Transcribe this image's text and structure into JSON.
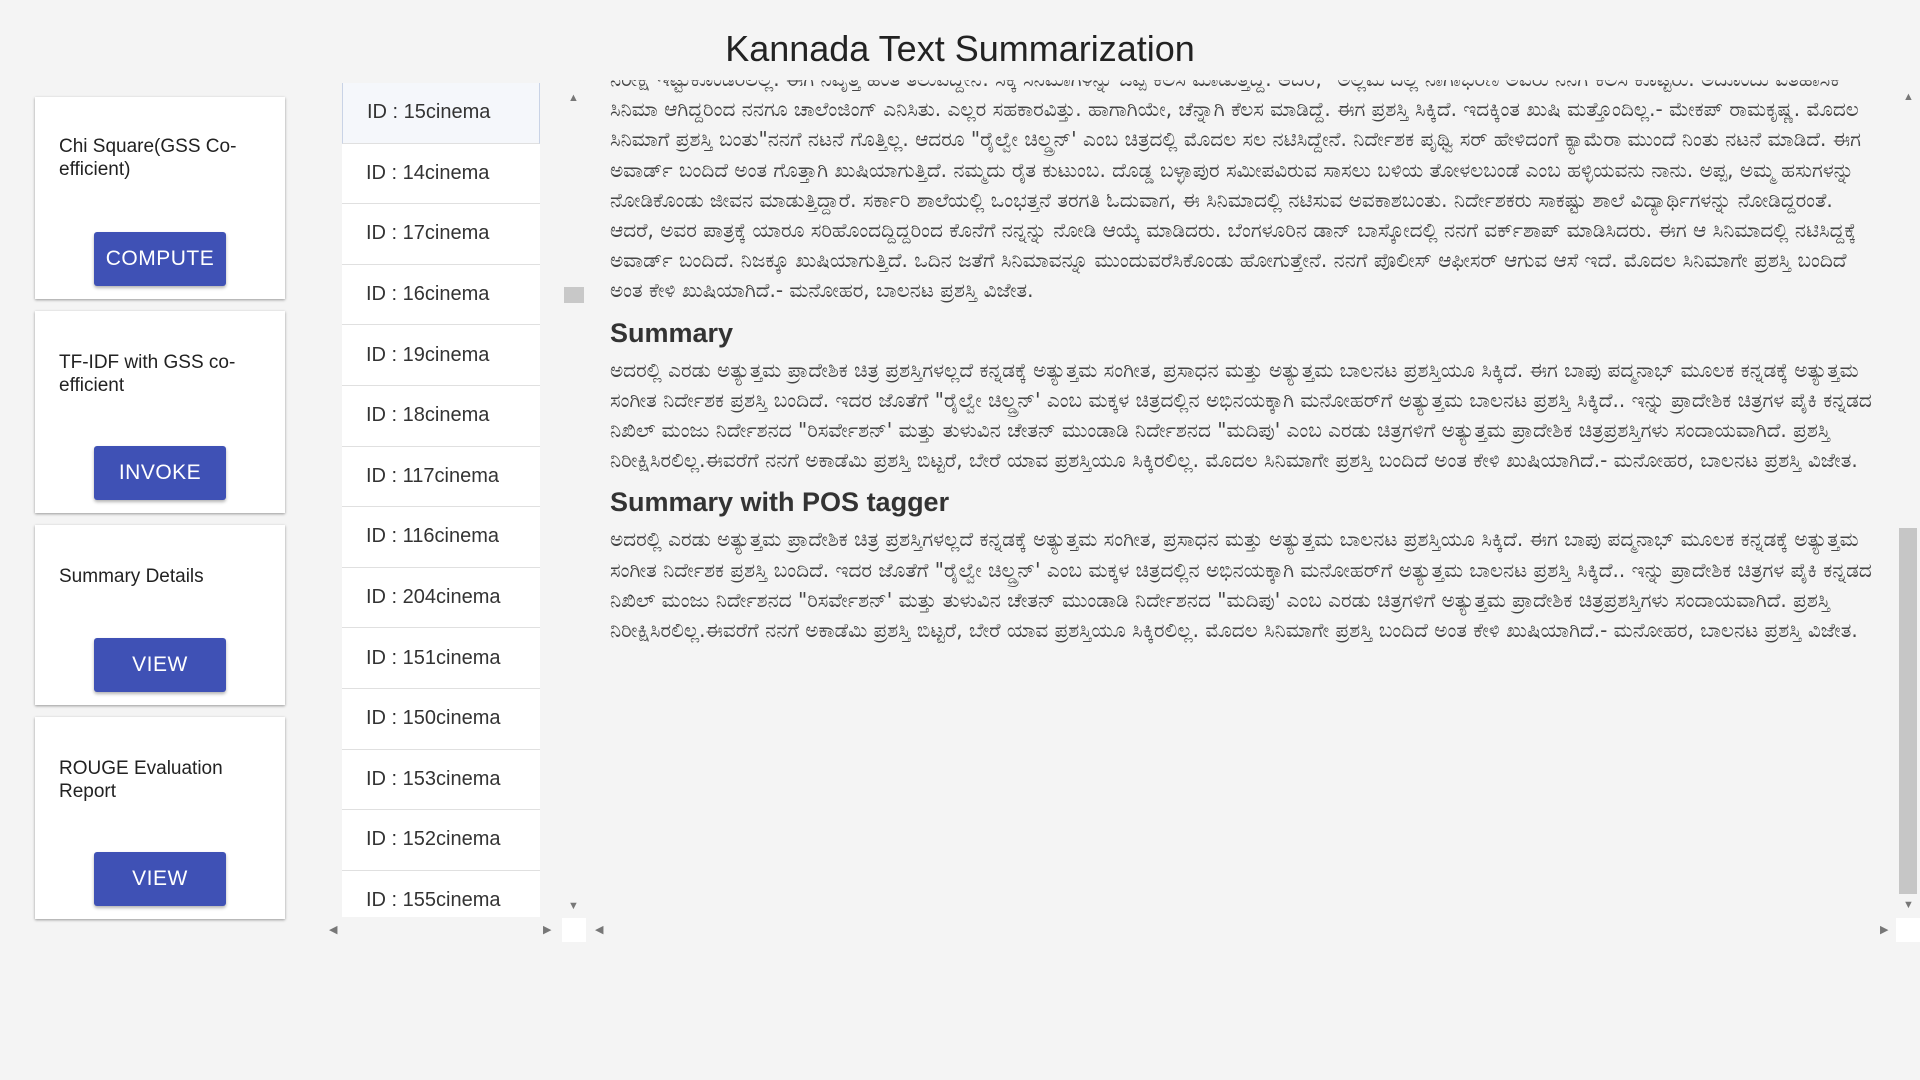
{
  "page": {
    "title": "Kannada Text Summarization"
  },
  "cards": [
    {
      "title": "Chi Square(GSS Co-efficient)",
      "button": "COMPUTE"
    },
    {
      "title": "TF-IDF with GSS co-efficient",
      "button": "INVOKE"
    },
    {
      "title": "Summary Details",
      "button": "VIEW"
    },
    {
      "title": "ROUGE Evaluation Report",
      "button": "VIEW"
    }
  ],
  "ids": [
    "ID : 15cinema",
    "ID : 14cinema",
    "ID : 17cinema",
    "ID : 16cinema",
    "ID : 19cinema",
    "ID : 18cinema",
    "ID : 117cinema",
    "ID : 116cinema",
    "ID : 204cinema",
    "ID : 151cinema",
    "ID : 150cinema",
    "ID : 153cinema",
    "ID : 152cinema",
    "ID : 155cinema"
  ],
  "content": {
    "original_text": "ನಿರೀಕ್ಷೆ ಇಟ್ಟುಕೊಂಡಿರಲಿಲ್ಲ. ಈಗ ನಿವೃತ್ತಿ ಹಂತ ತಲುಪಿದ್ದೇನೆ. ಸಿಕ್ಕ ಸಿನಿಮಾಗಳನ್ನು ಒಪ್ಪಿ ಕೆಲಸ ಮಾಡುತ್ತಿದ್ದೆ. ಆದರೆ, \"ಅಲ್ಲಮ'ದಲ್ಲಿ ನಾಗಾಭರಣ ಅವರು ನನಗೆ ಕೆಲಸ ಕೊಟ್ಟರು. ಅದೊಂದು ಐತಿಹಾಸಿಕ ಸಿನಿಮಾ ಆಗಿದ್ದರಿಂದ ನನಗೂ ಚಾಲೆಂಜಿಂಗ್ ಎನಿಸಿತು. ಎಲ್ಲರ ಸಹಕಾರವಿತ್ತು. ಹಾಗಾಗಿಯೇ, ಚೆನ್ನಾಗಿ ಕೆಲಸ ಮಾಡಿದ್ದೆ. ಈಗ ಪ್ರಶಸ್ತಿ ಸಿಕ್ಕಿದೆ. ಇದಕ್ಕಿಂತ ಖುಷಿ ಮತ್ತೊಂದಿಲ್ಲ.- ಮೇಕಪ್ ರಾಮಕೃಷ್ಣ. ಮೊದಲ ಸಿನಿಮಾಗೆ ಪ್ರಶಸ್ತಿ ಬಂತು\"ನನಗೆ ನಟನೆ ಗೊತ್ತಿಲ್ಲ. ಆದರೂ \"ರೈಲ್ವೇ ಚಿಲ್ಡ್ರನ್' ಎಂಬ ಚಿತ್ರದಲ್ಲಿ ಮೊದಲ ಸಲ ನಟಿಸಿದ್ದೇನೆ. ನಿರ್ದೇಶಕ ಪೃಥ್ವಿ ಸರ್ ಹೇಳಿದಂಗೆ ಕ್ಯಾಮೆರಾ ಮುಂದೆ ನಿಂತು ನಟನೆ ಮಾಡಿದೆ. ಈಗ ಅವಾರ್ಡ್ ಬಂದಿದೆ ಅಂತ ಗೊತ್ತಾಗಿ ಖುಷಿಯಾಗುತ್ತಿದೆ. ನಮ್ಮದು ರೈತ ಕುಟುಂಬ. ದೊಡ್ಡ ಬಳ್ಳಾಪುರ ಸಮೀಪವಿರುವ ಸಾಸಲು ಬಳಿಯ ತೋಳಲಬಂಡೆ ಎಂಬ ಹಳ್ಳಿಯವನು ನಾನು. ಅಪ್ಪ, ಅಮ್ಮ ಹಸುಗಳನ್ನು ನೋಡಿಕೊಂಡು ಜೀವನ ಮಾಡುತ್ತಿದ್ದಾರೆ. ಸರ್ಕಾರಿ ಶಾಲೆಯಲ್ಲಿ ಒಂಭತ್ತನೆ ತರಗತಿ ಓದುವಾಗ, ಈ ಸಿನಿಮಾದಲ್ಲಿ ನಟಿಸುವ ಅವಕಾಶಬಂತು. ನಿರ್ದೇಶಕರು ಸಾಕಷ್ಟು ಶಾಲೆ ವಿದ್ಯಾರ್ಥಿಗಳನ್ನು ನೋಡಿದ್ದರಂತೆ. ಆದರೆ, ಅವರ ಪಾತ್ರಕ್ಕೆ ಯಾರೂ ಸರಿಹೊಂದದ್ದಿದ್ದರಿಂದ ಕೊನೆಗೆ ನನ್ನನ್ನು ನೋಡಿ ಆಯ್ಕೆ ಮಾಡಿದರು. ಬೆಂಗಳೂರಿನ ಡಾನ್ ಬಾಸ್ಕೋದಲ್ಲಿ ನನಗೆ ವರ್ಕ್‌ಶಾಪ್ ಮಾಡಿಸಿದರು. ಈಗ ಆ ಸಿನಿಮಾದಲ್ಲಿ ನಟಿಸಿದ್ದಕ್ಕೆ ಅವಾರ್ಡ್ ಬಂದಿದೆ. ನಿಜಕ್ಕೂ ಖುಷಿಯಾಗುತ್ತಿದೆ.  ಒದಿನ ಜತೆಗೆ ಸಿನಿಮಾವನ್ನೂ ಮುಂದುವರೆಸಿಕೊಂಡು ಹೋಗುತ್ತೇನೆ. ನನಗೆ ಪೊಲೀಸ್ ಆಫೀಸರ್ ಆಗುವ ಆಸೆ ಇದೆ. ಮೊದಲ ಸಿನಿಮಾಗೇ ಪ್ರಶಸ್ತಿ ಬಂದಿದೆ ಅಂತ ಕೇಳಿ ಖುಷಿಯಾಗಿದೆ.- ಮನೋಹರ, ಬಾಲನಟ ಪ್ರಶಸ್ತಿ ವಿಜೇತ.",
    "summary_heading": "Summary",
    "summary_text": "ಅದರಲ್ಲಿ ಎರಡು ಅತ್ಯುತ್ತಮ ಪ್ರಾದೇಶಿಕ ಚಿತ್ರ ಪ್ರಶಸ್ತಿಗಳಲ್ಲದೆ ಕನ್ನಡಕ್ಕೆ ಅತ್ಯುತ್ತಮ ಸಂಗೀತ, ಪ್ರಸಾಧನ ಮತ್ತು ಅತ್ಯುತ್ತಮ ಬಾಲನಟ ಪ್ರಶಸ್ತಿಯೂ ಸಿಕ್ಕಿದೆ. ಈಗ ಬಾಪು ಪದ್ಮನಾಭ್ ಮೂಲಕ ಕನ್ನಡಕ್ಕೆ ಅತ್ಯುತ್ತಮ ಸಂಗೀತ ನಿರ್ದೇಶಕ ಪ್ರಶಸ್ತಿ ಬಂದಿದೆ. ಇದರ ಜೊತೆಗೆ \"ರೈಲ್ವೇ ಚಿಲ್ಡ್ರನ್' ಎಂಬ ಮಕ್ಕಳ ಚಿತ್ರದಲ್ಲಿನ ಅಭಿನಯಕ್ಕಾಗಿ ಮನೋಹರ್‌ಗೆ ಅತ್ಯುತ್ತಮ ಬಾಲನಟ ಪ್ರಶಸ್ತಿ ಸಿಕ್ಕಿದೆ.. ಇನ್ನು ಪ್ರಾದೇಶಿಕ ಚಿತ್ರಗಳ ಪೈಕಿ ಕನ್ನಡದ ನಿಖಿಲ್ ಮಂಜು ನಿರ್ದೇಶನದ \"ರಿಸರ್ವೇಶನ್' ಮತ್ತು ತುಳುವಿನ ಚೇತನ್ ಮುಂಡಾಡಿ ನಿರ್ದೇಶನದ \"ಮದಿಪು' ಎಂಬ ಎರಡು ಚಿತ್ರಗಳಿಗೆ ಅತ್ಯುತ್ತಮ ಪ್ರಾದೇಶಿಕ ಚಿತ್ರಪ್ರಶಸ್ತಿಗಳು ಸಂದಾಯವಾಗಿದೆ. ಪ್ರಶಸ್ತಿ ನಿರೀಕ್ಷಿಸಿರಲಿಲ್ಲ.ಈವರೆಗೆ ನನಗೆ ಅಕಾಡೆಮಿ ಪ್ರಶಸ್ತಿ ಬಿಟ್ಟರೆ, ಬೇರೆ ಯಾವ ಪ್ರಶಸ್ತಿಯೂ ಸಿಕ್ಕಿರಲಿಲ್ಲ. ಮೊದಲ ಸಿನಿಮಾಗೇ ಪ್ರಶಸ್ತಿ ಬಂದಿದೆ ಅಂತ ಕೇಳಿ ಖುಷಿಯಾಗಿದೆ.- ಮನೋಹರ, ಬಾಲನಟ ಪ್ರಶಸ್ತಿ ವಿಜೇತ.",
    "pos_heading": "Summary with POS tagger",
    "pos_text": "ಅದರಲ್ಲಿ ಎರಡು ಅತ್ಯುತ್ತಮ ಪ್ರಾದೇಶಿಕ ಚಿತ್ರ ಪ್ರಶಸ್ತಿಗಳಲ್ಲದೆ ಕನ್ನಡಕ್ಕೆ ಅತ್ಯುತ್ತಮ ಸಂಗೀತ, ಪ್ರಸಾಧನ ಮತ್ತು ಅತ್ಯುತ್ತಮ ಬಾಲನಟ ಪ್ರಶಸ್ತಿಯೂ ಸಿಕ್ಕಿದೆ. ಈಗ ಬಾಪು ಪದ್ಮನಾಭ್ ಮೂಲಕ ಕನ್ನಡಕ್ಕೆ ಅತ್ಯುತ್ತಮ ಸಂಗೀತ ನಿರ್ದೇಶಕ ಪ್ರಶಸ್ತಿ ಬಂದಿದೆ. ಇದರ ಜೊತೆಗೆ \"ರೈಲ್ವೇ ಚಿಲ್ಡ್ರನ್' ಎಂಬ ಮಕ್ಕಳ ಚಿತ್ರದಲ್ಲಿನ ಅಭಿನಯಕ್ಕಾಗಿ ಮನೋಹರ್‌ಗೆ ಅತ್ಯುತ್ತಮ ಬಾಲನಟ ಪ್ರಶಸ್ತಿ ಸಿಕ್ಕಿದೆ.. ಇನ್ನು ಪ್ರಾದೇಶಿಕ ಚಿತ್ರಗಳ ಪೈಕಿ ಕನ್ನಡದ ನಿಖಿಲ್ ಮಂಜು ನಿರ್ದೇಶನದ \"ರಿಸರ್ವೇಶನ್' ಮತ್ತು ತುಳುವಿನ ಚೇತನ್ ಮುಂಡಾಡಿ ನಿರ್ದೇಶನದ \"ಮದಿಪು' ಎಂಬ ಎರಡು ಚಿತ್ರಗಳಿಗೆ ಅತ್ಯುತ್ತಮ ಪ್ರಾದೇಶಿಕ ಚಿತ್ರಪ್ರಶಸ್ತಿಗಳು ಸಂದಾಯವಾಗಿದೆ. ಪ್ರಶಸ್ತಿ ನಿರೀಕ್ಷಿಸಿರಲಿಲ್ಲ.ಈವರೆಗೆ ನನಗೆ ಅಕಾಡೆಮಿ ಪ್ರಶಸ್ತಿ ಬಿಟ್ಟರೆ, ಬೇರೆ ಯಾವ ಪ್ರಶಸ್ತಿಯೂ ಸಿಕ್ಕಿರಲಿಲ್ಲ. ಮೊದಲ ಸಿನಿಮಾಗೇ ಪ್ರಶಸ್ತಿ ಬಂದಿದೆ ಅಂತ ಕೇಳಿ ಖುಷಿಯಾಗಿದೆ.- ಮನೋಹರ, ಬಾಲನಟ ಪ್ರಶಸ್ತಿ ವಿಜೇತ."
  },
  "scroll": {
    "up_glyph": "▲",
    "down_glyph": "▼",
    "left_glyph": "◀",
    "right_glyph": "▶"
  },
  "colors": {
    "accent": "#3f51b5",
    "background": "#f4f4f4"
  }
}
